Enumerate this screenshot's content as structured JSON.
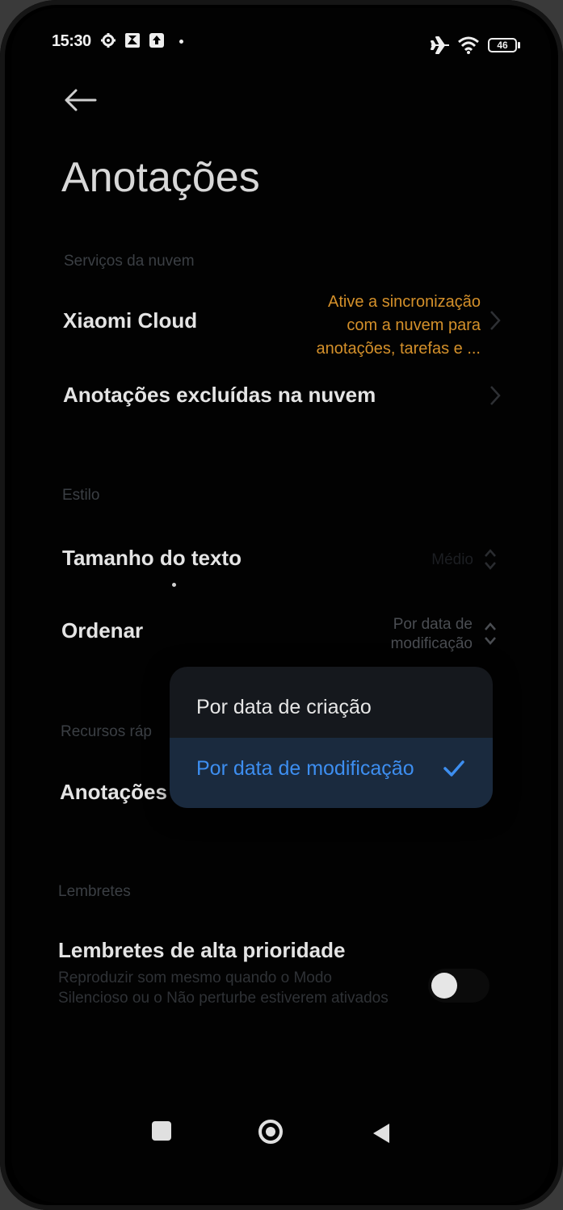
{
  "status_bar": {
    "time": "15:30",
    "battery": "46",
    "left_icons": [
      "settings-gear-icon",
      "gallery-icon",
      "upload-icon",
      "dot-icon"
    ],
    "right_icons": [
      "airplane-icon",
      "wifi-icon",
      "battery-icon"
    ]
  },
  "header": {
    "back_icon": "back-arrow-icon",
    "title": "Anotações"
  },
  "sections": {
    "cloud": {
      "heading": "Serviços da nuvem",
      "xiaomi_cloud": {
        "label": "Xiaomi Cloud",
        "hint_line1": "Ative a sincronização",
        "hint_line2": "com a nuvem para",
        "hint_line3": "anotações, tarefas e ..."
      },
      "deleted_notes": {
        "label": "Anotações excluídas na nuvem"
      }
    },
    "style": {
      "heading": "Estilo",
      "text_size": {
        "label": "Tamanho do texto",
        "value": "Médio"
      },
      "sort": {
        "label": "Ordenar",
        "value_line1": "Por data de",
        "value_line2": "modificação"
      }
    },
    "quick": {
      "heading": "Recursos ráp",
      "item_label": "Anotações"
    },
    "reminders": {
      "heading": "Lembretes",
      "high_priority": {
        "label": "Lembretes de alta prioridade",
        "description": "Reproduzir som mesmo quando o Modo Silencioso ou o Não perturbe estiverem ativados",
        "enabled": false
      }
    }
  },
  "sort_menu": {
    "options": [
      {
        "label": "Por data de criação",
        "selected": false
      },
      {
        "label": "Por data de modificação",
        "selected": true
      }
    ],
    "check_icon": "checkmark-icon"
  },
  "colors": {
    "accent": "#3d8ef0",
    "sync_hint": "#d4902a",
    "background": "#020202",
    "menu_bg": "#15181d"
  },
  "nav_bar": [
    "recents-square-icon",
    "home-circle-icon",
    "back-triangle-icon"
  ]
}
